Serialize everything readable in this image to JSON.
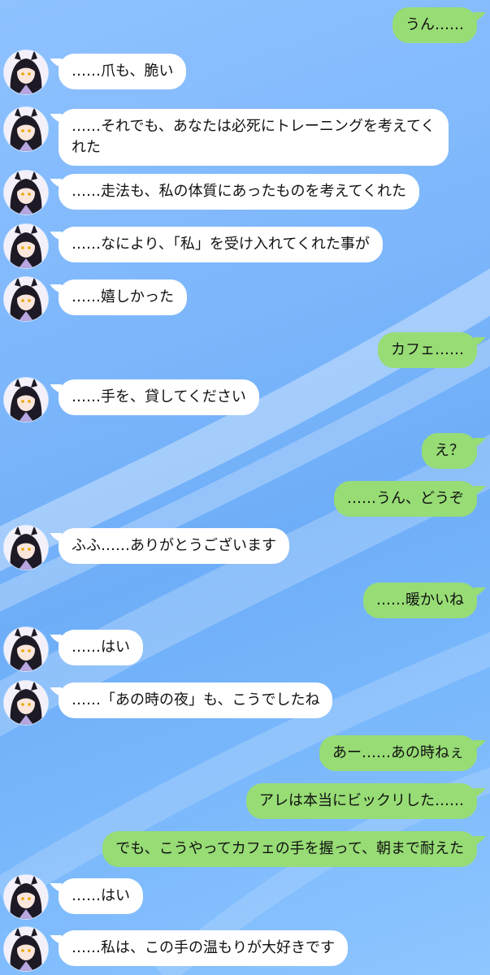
{
  "theme": {
    "incoming_bubble": "#ffffff",
    "outgoing_bubble": "#97dc75",
    "background": "#7cb6fb",
    "avatar_icon": "character-avatar-icon"
  },
  "messages": [
    {
      "side": "right",
      "text": "うん……"
    },
    {
      "side": "left",
      "text": "……爪も、脆い"
    },
    {
      "side": "left",
      "text": "……それでも、あなたは必死にトレーニングを考えてくれた"
    },
    {
      "side": "left",
      "text": "……走法も、私の体質にあったものを考えてくれた"
    },
    {
      "side": "left",
      "text": "……なにより、「私」を受け入れてくれた事が"
    },
    {
      "side": "left",
      "text": "……嬉しかった"
    },
    {
      "side": "right",
      "text": "カフェ……"
    },
    {
      "side": "left",
      "text": "……手を、貸してください"
    },
    {
      "side": "right",
      "text": "え？"
    },
    {
      "side": "right",
      "text": "……うん、どうぞ"
    },
    {
      "side": "left",
      "text": "ふふ……ありがとうございます"
    },
    {
      "side": "right",
      "text": "……暖かいね"
    },
    {
      "side": "left",
      "text": "……はい"
    },
    {
      "side": "left",
      "text": "……「あの時の夜」も、こうでしたね"
    },
    {
      "side": "right",
      "text": "あー……あの時ねぇ"
    },
    {
      "side": "right",
      "text": "アレは本当にビックリした……"
    },
    {
      "side": "right",
      "text": "でも、こうやってカフェの手を握って、朝まで耐えた"
    },
    {
      "side": "left",
      "text": "……はい"
    },
    {
      "side": "left",
      "text": "……私は、この手の温もりが大好きです"
    }
  ]
}
